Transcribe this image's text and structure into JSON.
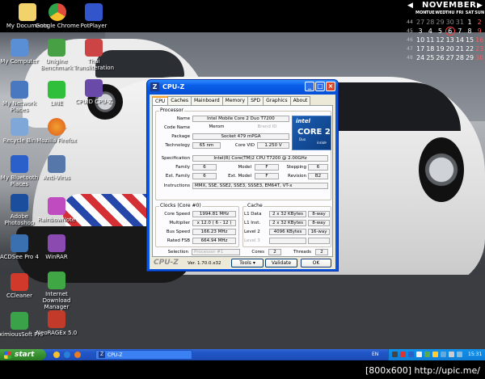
{
  "desktop_icons_top": [
    {
      "label": "My Documents",
      "icon": "folder-documents-icon",
      "color": "#f2d26a"
    },
    {
      "label": "Google Chrome",
      "icon": "chrome-icon",
      "color": "#e04a3b"
    },
    {
      "label": "PotPlayer",
      "icon": "potplayer-icon",
      "color": "#3355cc"
    }
  ],
  "desktop_icons_left": [
    {
      "label": "My Computer",
      "icon": "computer-icon",
      "color": "#5a8fd6"
    },
    {
      "label": "My Network Places",
      "icon": "network-icon",
      "color": "#4a78c0"
    },
    {
      "label": "Recycle Bin",
      "icon": "recycle-bin-icon",
      "color": "#7fa7d8"
    },
    {
      "label": "My Bluetooth Places",
      "icon": "bluetooth-icon",
      "color": "#2b5fc9"
    },
    {
      "label": "Adobe Photoshop",
      "icon": "photoshop-icon",
      "color": "#1b4f9e"
    },
    {
      "label": "ACDSee Pro 4",
      "icon": "acdsee-icon",
      "color": "#3a6fb0"
    },
    {
      "label": "CCleaner",
      "icon": "ccleaner-icon",
      "color": "#d13a2a"
    },
    {
      "label": "EximiousSoft Pro",
      "icon": "eximious-icon",
      "color": "#3aa34a"
    }
  ],
  "desktop_icons_second": [
    {
      "label": "Unigine Benchmark",
      "icon": "benchmark-icon",
      "color": "#48a044"
    },
    {
      "label": "LINE",
      "icon": "line-icon",
      "color": "#2fbf3a"
    },
    {
      "label": "Mozilla Firefox",
      "icon": "firefox-icon",
      "color": "#e87a24"
    },
    {
      "label": "Anti-Virus",
      "icon": "antivirus-icon",
      "color": "#5577aa"
    },
    {
      "label": "RainbowNote",
      "icon": "rainbow-icon",
      "color": "#c04ac0"
    },
    {
      "label": "WinRAR",
      "icon": "winrar-icon",
      "color": "#8a4ab0"
    },
    {
      "label": "Internet Download Manager",
      "icon": "idm-icon",
      "color": "#3fa845"
    },
    {
      "label": "NeoRAGEx 5.0",
      "icon": "neoragex-icon",
      "color": "#c23a2a"
    }
  ],
  "desktop_icons_third": [
    {
      "label": "Thai Transliteration",
      "icon": "thai-icon",
      "color": "#cc4444"
    },
    {
      "label": "CPUID CPU-Z",
      "icon": "cpuz-icon",
      "color": "#6a4aa8"
    }
  ],
  "calendar": {
    "month": "NOVEMBER",
    "prev": "◀",
    "next": "▶",
    "dows": [
      "MON",
      "TUE",
      "WED",
      "THU",
      "FRI",
      "SAT",
      "SUN"
    ],
    "weeks": [
      {
        "wk": "44",
        "days": [
          "27",
          "28",
          "29",
          "30",
          "31",
          "1",
          "2"
        ]
      },
      {
        "wk": "45",
        "days": [
          "3",
          "4",
          "5",
          "6",
          "7",
          "8",
          "9"
        ]
      },
      {
        "wk": "46",
        "days": [
          "10",
          "11",
          "12",
          "13",
          "14",
          "15",
          "16"
        ]
      },
      {
        "wk": "47",
        "days": [
          "17",
          "18",
          "19",
          "20",
          "21",
          "22",
          "23"
        ]
      },
      {
        "wk": "48",
        "days": [
          "24",
          "25",
          "26",
          "27",
          "28",
          "29",
          "30"
        ]
      }
    ]
  },
  "cpuz": {
    "title": "CPU-Z",
    "tabs": [
      "CPU",
      "Caches",
      "Mainboard",
      "Memory",
      "SPD",
      "Graphics",
      "About"
    ],
    "active_tab": "CPU",
    "processor": {
      "group_label": "Processor",
      "name_label": "Name",
      "name": "Intel Mobile Core 2 Duo T7200",
      "codename_label": "Code Name",
      "codename": "Merom",
      "brandid": "Brand ID",
      "package_label": "Package",
      "package": "Socket 479 mPGA",
      "technology_label": "Technology",
      "technology": "65 nm",
      "corevid_label": "Core VID",
      "corevid": "1.250 V",
      "spec_label": "Specification",
      "spec": "Intel(R) Core(TM)2 CPU        T7200  @ 2.00GHz",
      "family_label": "Family",
      "family": "6",
      "model_label": "Model",
      "model": "F",
      "stepping_label": "Stepping",
      "stepping": "6",
      "extfamily_label": "Ext. Family",
      "extfamily": "6",
      "extmodel_label": "Ext. Model",
      "extmodel": "F",
      "revision_label": "Revision",
      "revision": "B2",
      "instructions_label": "Instructions",
      "instructions": "MMX, SSE, SSE2, SSE3, SSSE3, EM64T, VT-x"
    },
    "intel_logo": {
      "brand": "intel",
      "line": "CORE 2",
      "sub": "Duo",
      "inside": "inside"
    },
    "clocks": {
      "group_label": "Clocks (Core #0)",
      "corespeed_label": "Core Speed",
      "corespeed": "1994.81 MHz",
      "multiplier_label": "Multiplier",
      "multiplier": "x 12.0 ( 6 - 12 )",
      "busspeed_label": "Bus Speed",
      "busspeed": "166.23 MHz",
      "ratedfsb_label": "Rated FSB",
      "ratedfsb": "664.94 MHz"
    },
    "cache": {
      "group_label": "Cache",
      "l1d_label": "L1 Data",
      "l1d": "2 x 32 KBytes",
      "l1d_way": "8-way",
      "l1i_label": "L1 Inst.",
      "l1i": "2 x 32 KBytes",
      "l1i_way": "8-way",
      "l2_label": "Level 2",
      "l2": "4096 KBytes",
      "l2_way": "16-way",
      "l3_label": "Level 3"
    },
    "selection_label": "Selection",
    "selection": "Processor #1",
    "cores_label": "Cores",
    "cores": "2",
    "threads_label": "Threads",
    "threads": "2",
    "brand": "CPU-Z",
    "version": "Ver. 1.70.0.x32",
    "tools_label": "Tools",
    "validate_label": "Validate",
    "ok_label": "OK"
  },
  "taskbar": {
    "start_label": "start",
    "task_label": "CPU-Z",
    "lang": "EN",
    "clock": "15:31"
  },
  "watermark": "[800x600] http://upic.me/"
}
